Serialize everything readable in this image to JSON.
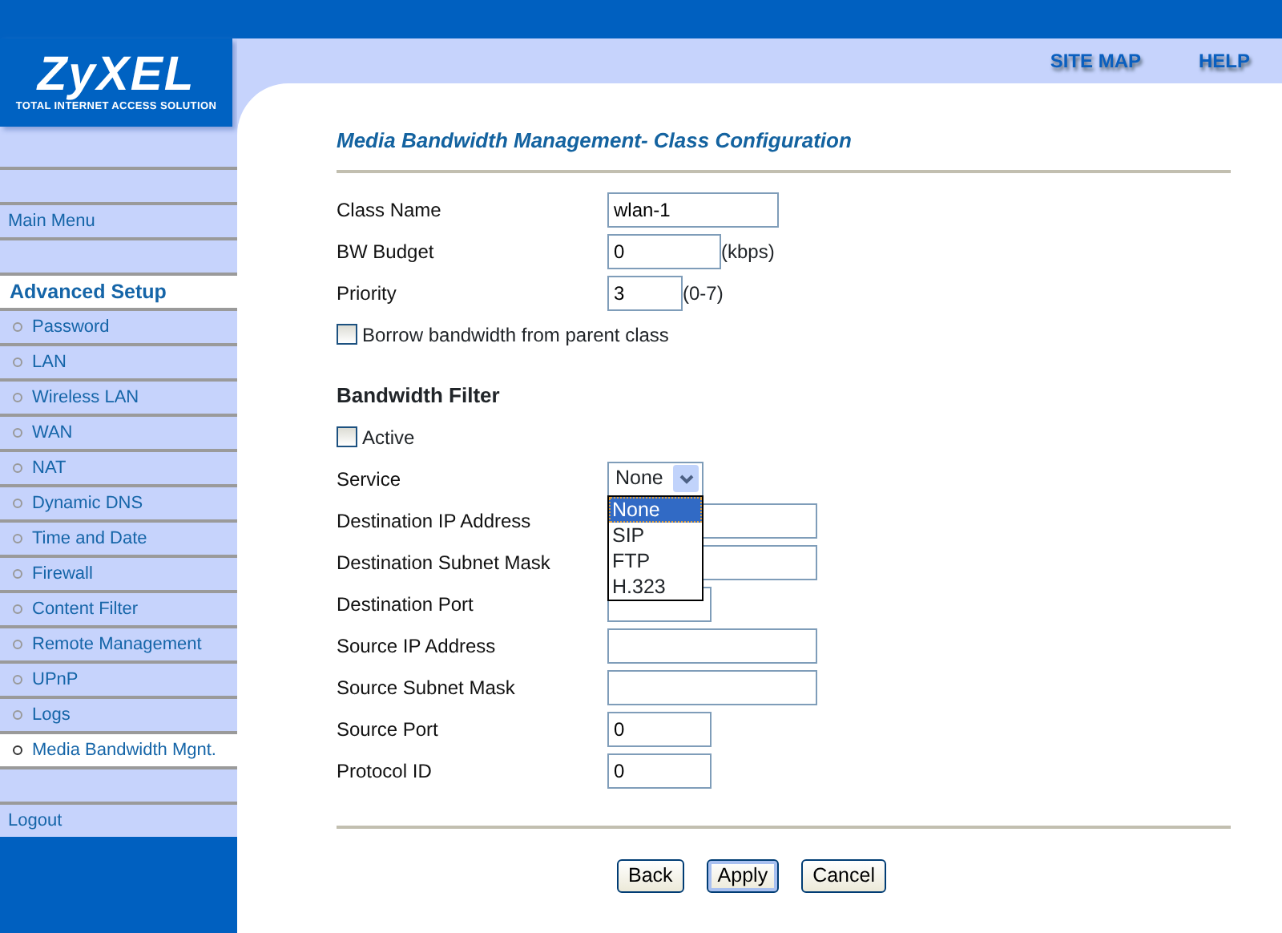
{
  "logo": {
    "name": "ZyXEL",
    "tagline": "TOTAL INTERNET ACCESS SOLUTION"
  },
  "top_links": [
    "SITE MAP",
    "HELP"
  ],
  "sidebar": {
    "items": [
      {
        "kind": "blank"
      },
      {
        "kind": "link",
        "label": "Main Menu",
        "selected": false
      },
      {
        "kind": "blank"
      },
      {
        "kind": "heading",
        "label": "Advanced Setup",
        "selected": true
      },
      {
        "kind": "sub",
        "label": "Password",
        "selected": false
      },
      {
        "kind": "sub",
        "label": "LAN",
        "selected": false
      },
      {
        "kind": "sub",
        "label": "Wireless LAN",
        "selected": false
      },
      {
        "kind": "sub",
        "label": "WAN",
        "selected": false
      },
      {
        "kind": "sub",
        "label": "NAT",
        "selected": false
      },
      {
        "kind": "sub",
        "label": "Dynamic DNS",
        "selected": false
      },
      {
        "kind": "sub",
        "label": "Time and Date",
        "selected": false
      },
      {
        "kind": "sub",
        "label": "Firewall",
        "selected": false
      },
      {
        "kind": "sub",
        "label": "Content Filter",
        "selected": false
      },
      {
        "kind": "sub",
        "label": "Remote Management",
        "selected": false
      },
      {
        "kind": "sub",
        "label": "UPnP",
        "selected": false
      },
      {
        "kind": "sub",
        "label": "Logs",
        "selected": false
      },
      {
        "kind": "sub",
        "label": "Media Bandwidth Mgnt.",
        "selected": true
      },
      {
        "kind": "blank"
      },
      {
        "kind": "link",
        "label": "Logout",
        "selected": false
      }
    ]
  },
  "page_title": "Media Bandwidth Management- Class Configuration",
  "form": [
    {
      "kind": "text",
      "label": "Class Name",
      "value": "wlan-1"
    },
    {
      "kind": "text",
      "label": "BW Budget",
      "value": "0",
      "unit": "(kbps)"
    },
    {
      "kind": "text",
      "label": "Priority",
      "value": "3",
      "unit": "(0-7)"
    },
    {
      "kind": "checkbox",
      "label": "Borrow bandwidth from parent class",
      "checked": false
    },
    {
      "kind": "heading",
      "label": "Bandwidth Filter"
    },
    {
      "kind": "checkbox",
      "label": "Active",
      "checked": false
    },
    {
      "kind": "select",
      "label": "Service",
      "value": "None",
      "expanded": true,
      "options": [
        {
          "label": "None",
          "selected": true
        },
        {
          "label": "SIP",
          "selected": false
        },
        {
          "label": "FTP",
          "selected": false
        },
        {
          "label": "H.323",
          "selected": false
        }
      ]
    },
    {
      "kind": "text",
      "label": "Destination IP Address"
    },
    {
      "kind": "text",
      "label": "Destination Subnet Mask"
    },
    {
      "kind": "text",
      "label": "Destination Port"
    },
    {
      "kind": "text",
      "label": "Source IP Address"
    },
    {
      "kind": "text",
      "label": "Source Subnet Mask"
    },
    {
      "kind": "text",
      "label": "Source Port",
      "value": "0"
    },
    {
      "kind": "text",
      "label": "Protocol ID",
      "value": "0"
    }
  ],
  "buttons": [
    {
      "label": "Back",
      "focused": false
    },
    {
      "label": "Apply",
      "focused": true
    },
    {
      "label": "Cancel",
      "focused": false
    }
  ]
}
